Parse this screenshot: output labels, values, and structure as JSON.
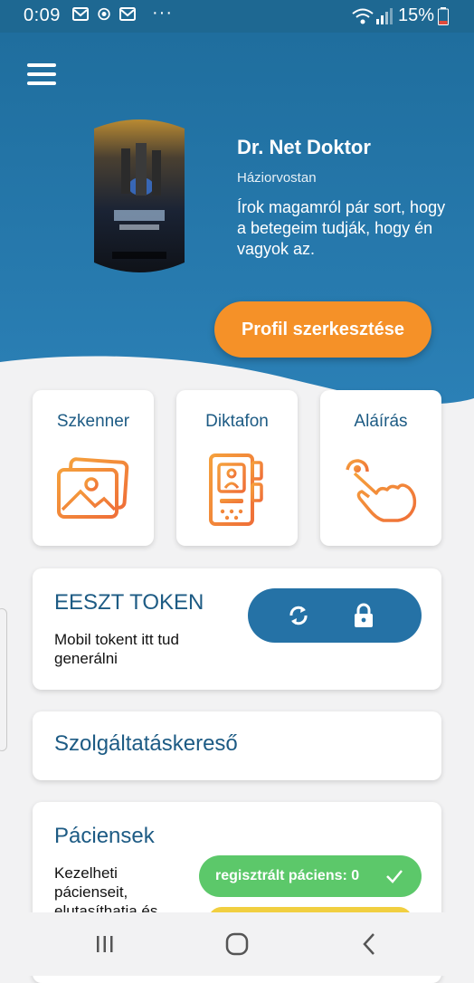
{
  "status_bar": {
    "time": "0:09",
    "dots": "···",
    "battery": "15%",
    "icons": [
      "gmail-icon",
      "sync-app-icon",
      "gmail-icon",
      "wifi-icon",
      "signal-icon",
      "battery-icon"
    ]
  },
  "colors": {
    "header_top": "#2070a0",
    "header_bottom": "#2a7db3",
    "accent_orange": "#f59128",
    "primary_blue": "#1d5b84",
    "green": "#5cc86a",
    "yellow": "#f1cf40"
  },
  "profile": {
    "name": "Dr. Net Doktor",
    "specialty": "Háziorvostan",
    "about": "Írok magamról pár sort, hogy a betegeim tudják, hogy én vagyok az.",
    "edit_button": "Profil szerkesztése"
  },
  "tiles": [
    {
      "label": "Szkenner",
      "icon": "image-gallery-icon"
    },
    {
      "label": "Diktafon",
      "icon": "voice-recorder-icon"
    },
    {
      "label": "Aláírás",
      "icon": "hand-tap-icon"
    }
  ],
  "token": {
    "title": "EESZT TOKEN",
    "description": "Mobil tokent itt tud generálni"
  },
  "service_search": {
    "label": "Szolgáltatáskereső"
  },
  "patients": {
    "title": "Páciensek",
    "description": "Kezelheti pácienseit, elutasíthatja és",
    "registered_badge": "regisztrált páciens: 0"
  }
}
